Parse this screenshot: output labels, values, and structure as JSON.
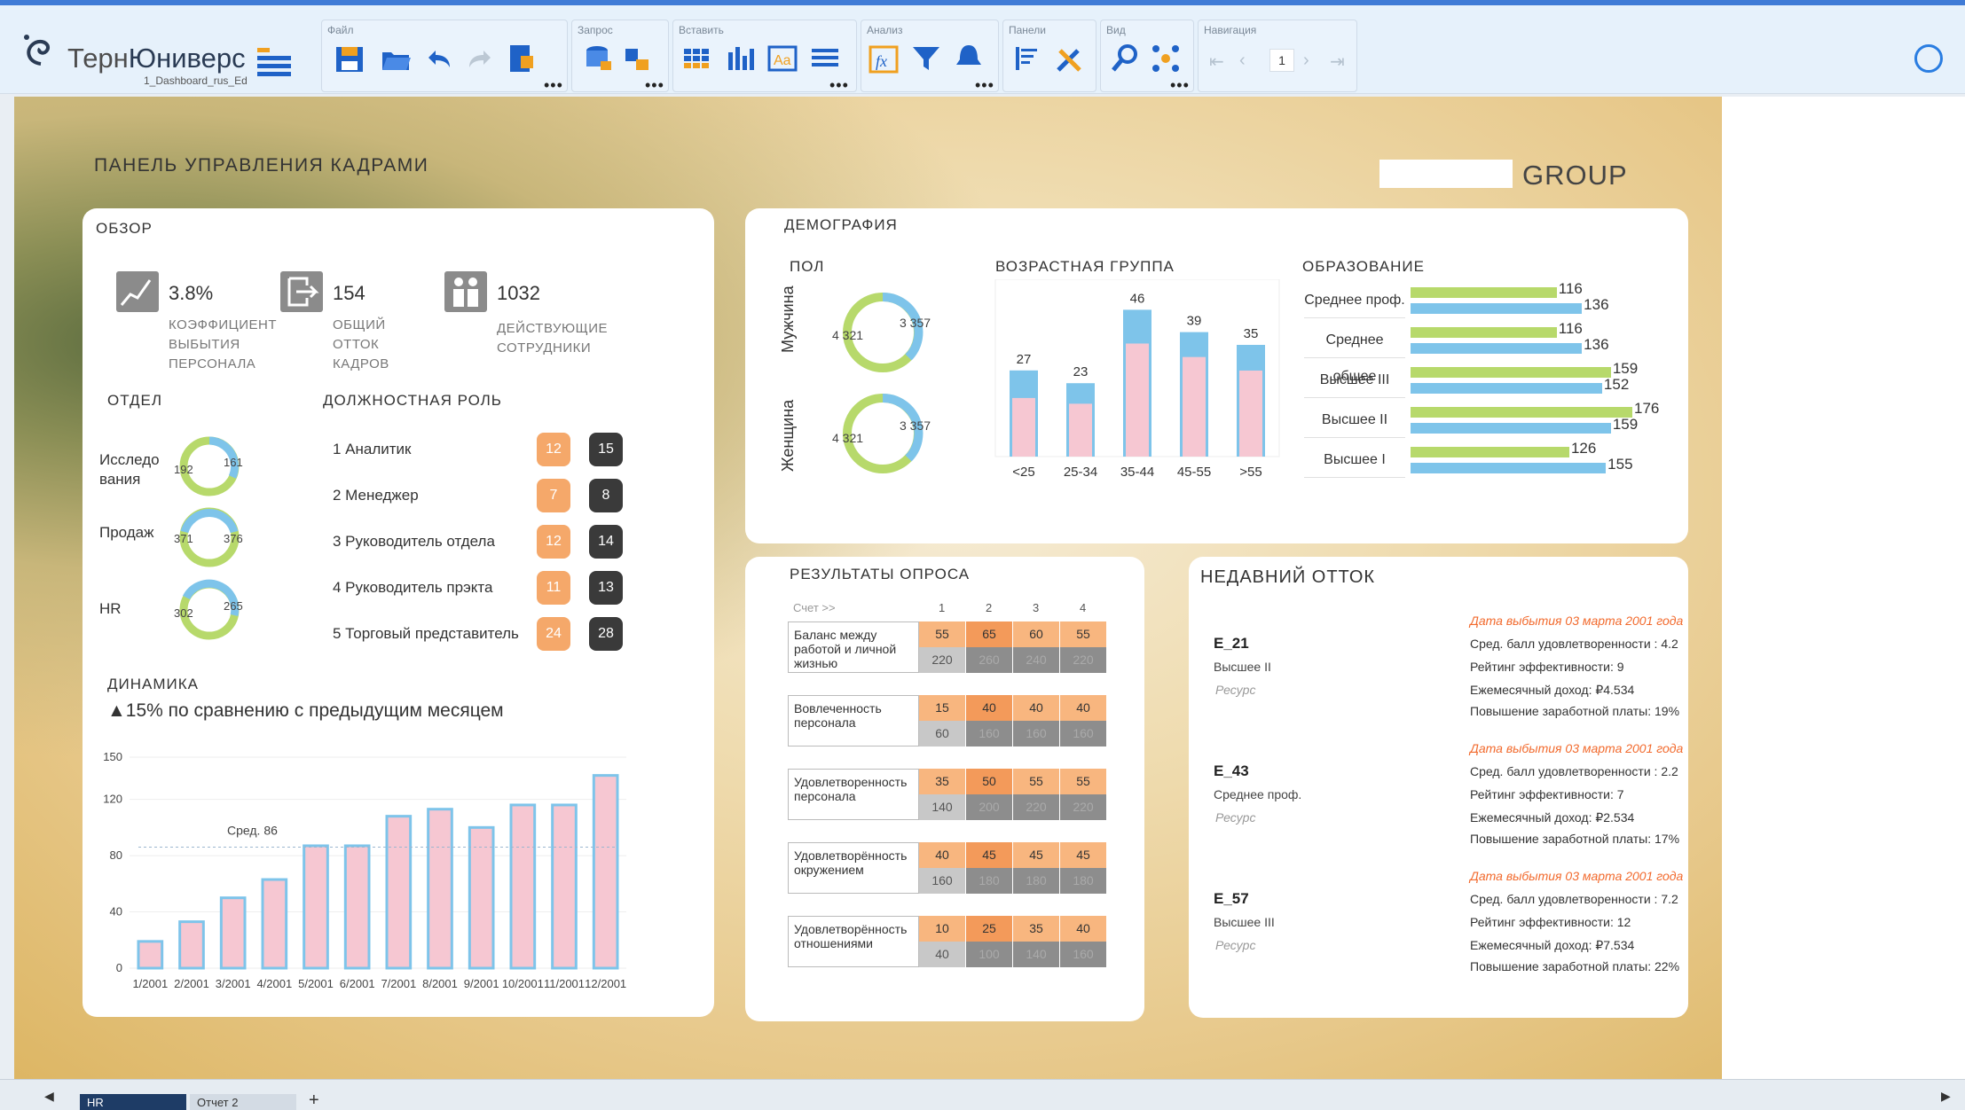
{
  "app": {
    "brand_prefix": "Терн",
    "brand_suffix": "Юниверс",
    "file_name": "1_Dashboard_rus_Ed"
  },
  "toolbar": {
    "groups": [
      {
        "label": "Файл"
      },
      {
        "label": "Запрос"
      },
      {
        "label": "Вставить"
      },
      {
        "label": "Анализ"
      },
      {
        "label": "Панели"
      },
      {
        "label": "Вид"
      },
      {
        "label": "Навигация"
      }
    ],
    "page_number": "1",
    "icons": [
      "save-icon",
      "open-folder-icon",
      "undo-icon",
      "redo-icon",
      "export-icon",
      "query-icon",
      "transform-icon",
      "table-icon",
      "bar-chart-icon",
      "text-icon",
      "list-icon",
      "formula-icon",
      "filter-icon",
      "alert-icon",
      "sort-icon",
      "tools-icon",
      "zoom-icon",
      "network-icon"
    ]
  },
  "dashboard": {
    "title": "ПАНЕЛЬ УПРАВЛЕНИЯ КАДРАМИ",
    "company": "GROUP"
  },
  "overview": {
    "title": "ОБЗОР",
    "kpis": [
      {
        "value": "3.8%",
        "label_lines": [
          "КОЭФФИЦИЕНТ",
          "ВЫБЫТИЯ",
          "ПЕРСОНАЛА"
        ]
      },
      {
        "value": "154",
        "label_lines": [
          "ОБЩИЙ",
          "ОТТОК",
          "КАДРОВ"
        ]
      },
      {
        "value": "1032",
        "label_lines": [
          "ДЕЙСТВУЮЩИЕ",
          "СОТРУДНИКИ"
        ]
      }
    ],
    "dept_title": "ОТДЕЛ",
    "departments": [
      {
        "name_lines": [
          "Исследо",
          "вания"
        ],
        "a": "192",
        "b": "161"
      },
      {
        "name_lines": [
          "Продаж"
        ],
        "a": "371",
        "b": "376"
      },
      {
        "name_lines": [
          "HR"
        ],
        "a": "302",
        "b": "265"
      }
    ],
    "role_title": "ДОЛЖНОСТНАЯ РОЛЬ",
    "roles": [
      {
        "num": "1",
        "name": "Аналитик",
        "a": "12",
        "b": "15"
      },
      {
        "num": "2",
        "name": "Менеджер",
        "a": "7",
        "b": "8"
      },
      {
        "num": "3",
        "name": "Руководитель отдела",
        "a": "12",
        "b": "14"
      },
      {
        "num": "4",
        "name": "Руководитель прэкта",
        "a": "11",
        "b": "13"
      },
      {
        "num": "5",
        "name": "Торговый представитель",
        "a": "24",
        "b": "28"
      }
    ],
    "dynamics_title": "ДИНАМИКА",
    "dynamics_sub": "▲15% по сравнению с предыдущим месяцем",
    "avg_label": "Сред. 86"
  },
  "demography": {
    "title": "ДЕМОГРАФИЯ",
    "gender_title": "ПОЛ",
    "genders": [
      {
        "name": "Мужчина",
        "a": "4 321",
        "b": "3 357"
      },
      {
        "name": "Женщина",
        "a": "4 321",
        "b": "3 357"
      }
    ],
    "age_title": "ВОЗРАСТНАЯ ГРУППА",
    "edu_title": "ОБРАЗОВАНИЕ"
  },
  "survey": {
    "title": "РЕЗУЛЬТАТЫ ОПРОСА",
    "score_hdr": "Счет >>",
    "cols": [
      "1",
      "2",
      "3",
      "4"
    ],
    "rows": [
      {
        "label_lines": [
          "Баланс между",
          "работой и личной",
          "жизнью"
        ],
        "top": [
          "55",
          "65",
          "60",
          "55"
        ],
        "bot": [
          "220",
          "260",
          "240",
          "220"
        ]
      },
      {
        "label_lines": [
          "Вовлеченность",
          "персонала"
        ],
        "top": [
          "15",
          "40",
          "40",
          "40"
        ],
        "bot": [
          "60",
          "160",
          "160",
          "160"
        ]
      },
      {
        "label_lines": [
          "Удовлетворенность",
          "персонала"
        ],
        "top": [
          "35",
          "50",
          "55",
          "55"
        ],
        "bot": [
          "140",
          "200",
          "220",
          "220"
        ]
      },
      {
        "label_lines": [
          "Удовлетворённость",
          "окружением"
        ],
        "top": [
          "40",
          "45",
          "45",
          "45"
        ],
        "bot": [
          "160",
          "180",
          "180",
          "180"
        ]
      },
      {
        "label_lines": [
          "Удовлетворённость",
          "отношениями"
        ],
        "top": [
          "10",
          "25",
          "35",
          "40"
        ],
        "bot": [
          "40",
          "100",
          "140",
          "160"
        ]
      }
    ]
  },
  "churn": {
    "title": "НЕДАВНИЙ ОТТОК",
    "items": [
      {
        "id": "E_21",
        "edu": "Высшее II",
        "res": "Ресурс",
        "date": "Дата выбытия 03 марта 2001 года",
        "l1": "Сред. балл удовлетворенности : 4.2",
        "l2": "Рейтинг эффективности: 9",
        "l3": "Ежемесячный доход: ₽4.534",
        "l4": "Повышение заработной платы: 19%"
      },
      {
        "id": "E_43",
        "edu": "Среднее проф.",
        "res": "Ресурс",
        "date": "Дата выбытия 03 марта 2001 года",
        "l1": "Сред. балл удовлетворенности : 2.2",
        "l2": "Рейтинг эффективности: 7",
        "l3": "Ежемесячный доход: ₽2.534",
        "l4": "Повышение заработной платы: 17%"
      },
      {
        "id": "E_57",
        "edu": "Высшее III",
        "res": "Ресурс",
        "date": "Дата выбытия 03 марта 2001 года",
        "l1": "Сред. балл удовлетворенности : 7.2",
        "l2": "Рейтинг эффективности: 12",
        "l3": "Ежемесячный доход: ₽7.534",
        "l4": "Повышение заработной платы: 22%"
      }
    ]
  },
  "tabs": {
    "t1": "HR",
    "t2": "Отчет 2",
    "add": "+"
  },
  "chart_data": [
    {
      "type": "bar",
      "categories": [
        "1/2001",
        "2/2001",
        "3/2001",
        "4/2001",
        "5/2001",
        "6/2001",
        "7/2001",
        "8/2001",
        "9/2001",
        "10/2001",
        "11/2001",
        "12/2001"
      ],
      "values": [
        19,
        33,
        50,
        63,
        87,
        87,
        108,
        113,
        100,
        116,
        116,
        137
      ],
      "ylim": [
        0,
        150
      ],
      "yticks": [
        0,
        40,
        80,
        120,
        150
      ],
      "avg": 86
    },
    {
      "type": "bar",
      "categories": [
        "<25",
        "25-34",
        "35-44",
        "45-55",
        ">55"
      ],
      "values": [
        27,
        23,
        46,
        39,
        35
      ],
      "stacked_inner_share": [
        0.68,
        0.72,
        0.77,
        0.8,
        0.77
      ]
    },
    {
      "type": "bar",
      "categories": [
        "Среднее проф.",
        "Среднее общее",
        "Высшее III",
        "Высшее II",
        "Высшее I"
      ],
      "series": [
        {
          "values": [
            116,
            116,
            159,
            176,
            126
          ]
        },
        {
          "values": [
            136,
            136,
            152,
            159,
            155
          ]
        }
      ]
    },
    {
      "type": "pie",
      "categories": [
        "Мужчина a",
        "Мужчина b"
      ],
      "values": [
        4321,
        3357
      ]
    }
  ],
  "colors": {
    "green": "#b7d96b",
    "blue": "#7ec4ea",
    "pink": "#f6c7d2",
    "orange": "#f5a86a",
    "dark": "#3a3a3a"
  }
}
